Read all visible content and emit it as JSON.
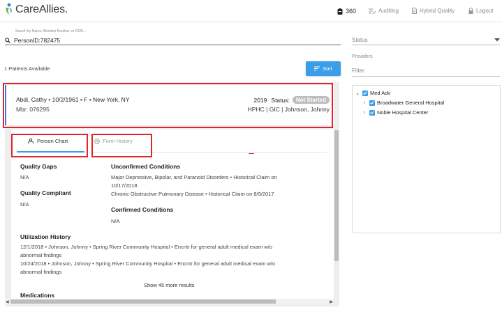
{
  "header": {
    "app_name": "CareAllies.",
    "nav": [
      {
        "label": "360",
        "icon": "clipboard-icon"
      },
      {
        "label": "Auditing",
        "icon": "list-check-icon"
      },
      {
        "label": "Hybrid Quality",
        "icon": "document-icon"
      },
      {
        "label": "Logout",
        "icon": "lock-icon"
      }
    ]
  },
  "search": {
    "placeholder_label": "Search by Name, Member Number, or DOB...",
    "value": "PersonID:782475"
  },
  "patients": {
    "count_label": "1 Patients Available",
    "sort_label": "Sort"
  },
  "patient_card": {
    "name_line": "Abdi, Cathy •  10/2/1961 •  F • New York, NY",
    "member": "Mbr: 076295",
    "year": "2019",
    "status_label": "Status:",
    "status_badge": "Not Started",
    "org_line": "HPHC | GIC | Johnson, Johnny"
  },
  "tabs": [
    {
      "label": "Person Chart",
      "icon": "person-icon",
      "active": true
    },
    {
      "label": "Form History",
      "icon": "clock-icon",
      "active": false
    }
  ],
  "chart": {
    "quality_gaps": {
      "title": "Quality Gaps",
      "value": "N/A"
    },
    "quality_compliant": {
      "title": "Quality Compliant",
      "value": "N/A"
    },
    "unconfirmed": {
      "title": "Unconfirmed Conditions",
      "items": [
        "Major Depressive, Bipolar, and Paranoid Disorders • Historical Claim on",
        "10/17/2018",
        "Chronic Obstructive Pulmonary Disease • Historical Claim on 8/9/2017"
      ]
    },
    "confirmed": {
      "title": "Confirmed Conditions",
      "value": "N/A"
    },
    "utilization": {
      "title": "Utilization History",
      "lines": [
        "12/1/2018 • Johnson, Johnny • Spring River Community Hospital • Encntr for general adult medical exam w/o",
        "abnormal findings",
        "10/24/2018 • Johnson, Johnny • Spring River Community Hospital • Encntr for general adult medical exam w/o",
        "abnormal findings"
      ]
    },
    "show_more": "Show 45 more results",
    "medications_title": "Medications"
  },
  "right_panel": {
    "status_placeholder": "Status",
    "providers_label": "Providers",
    "filter_placeholder": "Filter",
    "tree": [
      {
        "label": "Med Adv",
        "checked": true
      },
      {
        "label": "Broadwater General Hospital",
        "checked": true
      },
      {
        "label": "Noble Hospital Center",
        "checked": true
      }
    ]
  },
  "colors": {
    "accent_blue": "#3b9ee8",
    "highlight_red": "#e0262b",
    "logo_green": "#6cb33f"
  }
}
